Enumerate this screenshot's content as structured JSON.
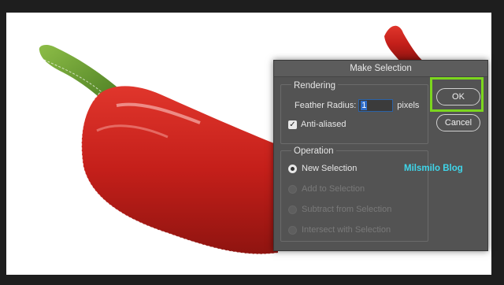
{
  "dialog": {
    "title": "Make Selection",
    "rendering": {
      "label": "Rendering",
      "feather_label": "Feather Radius:",
      "feather_value": "1",
      "feather_unit": "pixels",
      "anti_aliased_label": "Anti-aliased",
      "anti_aliased_checked": true
    },
    "operation": {
      "label": "Operation",
      "options": [
        {
          "label": "New Selection",
          "selected": true,
          "enabled": true
        },
        {
          "label": "Add to Selection",
          "selected": false,
          "enabled": false
        },
        {
          "label": "Subtract from Selection",
          "selected": false,
          "enabled": false
        },
        {
          "label": "Intersect with Selection",
          "selected": false,
          "enabled": false
        }
      ]
    },
    "buttons": {
      "ok": "OK",
      "cancel": "Cancel"
    }
  },
  "watermark": "Milsmilo Blog",
  "colors": {
    "highlight": "#7cd61e",
    "watermark": "#3fd6ea",
    "pepper": "#c9221c",
    "stem": "#6fa33a",
    "dialog_bg": "#535353"
  }
}
